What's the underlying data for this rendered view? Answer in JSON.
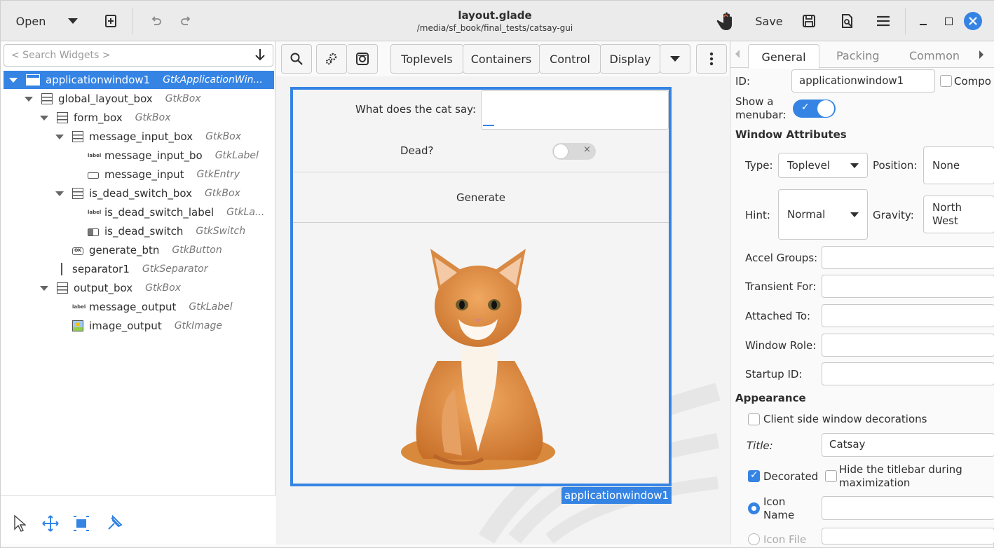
{
  "header": {
    "open_label": "Open",
    "title": "layout.glade",
    "path": "/media/sf_book/final_tests/catsay-gui",
    "save_label": "Save"
  },
  "left": {
    "search_placeholder": "< Search Widgets >",
    "tree": [
      {
        "name": "applicationwindow1",
        "type": "GtkApplicationWin...",
        "depth": 0,
        "expander": true,
        "icon": "window-icon",
        "selected": true
      },
      {
        "name": "global_layout_box",
        "type": "GtkBox",
        "depth": 1,
        "expander": true,
        "icon": "box-icon"
      },
      {
        "name": "form_box",
        "type": "GtkBox",
        "depth": 2,
        "expander": true,
        "icon": "box-icon"
      },
      {
        "name": "message_input_box",
        "type": "GtkBox",
        "depth": 3,
        "expander": true,
        "icon": "box-icon"
      },
      {
        "name": "message_input_bo",
        "type": "GtkLabel",
        "depth": 4,
        "icon": "label-icon"
      },
      {
        "name": "message_input",
        "type": "GtkEntry",
        "depth": 4,
        "icon": "entry-icon"
      },
      {
        "name": "is_dead_switch_box",
        "type": "GtkBox",
        "depth": 3,
        "expander": true,
        "icon": "box-icon"
      },
      {
        "name": "is_dead_switch_label",
        "type": "GtkLa...",
        "depth": 4,
        "icon": "label-icon"
      },
      {
        "name": "is_dead_switch",
        "type": "GtkSwitch",
        "depth": 4,
        "icon": "switch-icon"
      },
      {
        "name": "generate_btn",
        "type": "GtkButton",
        "depth": 3,
        "icon": "button-icon"
      },
      {
        "name": "separator1",
        "type": "GtkSeparator",
        "depth": 2,
        "icon": "separator-icon"
      },
      {
        "name": "output_box",
        "type": "GtkBox",
        "depth": 2,
        "expander": true,
        "icon": "box-icon"
      },
      {
        "name": "message_output",
        "type": "GtkLabel",
        "depth": 3,
        "icon": "label-icon"
      },
      {
        "name": "image_output",
        "type": "GtkImage",
        "depth": 3,
        "icon": "image-icon"
      }
    ]
  },
  "palette": {
    "tabs": [
      "Toplevels",
      "Containers",
      "Control",
      "Display"
    ]
  },
  "preview": {
    "question_label": "What does the cat say:",
    "dead_label": "Dead?",
    "generate_label": "Generate",
    "window_name": "applicationwindow1"
  },
  "props": {
    "tabs": [
      "General",
      "Packing",
      "Common"
    ],
    "id_label": "ID:",
    "id_value": "applicationwindow1",
    "compo_label": "Compo",
    "menubar_label_1": "Show a",
    "menubar_label_2": "menubar:",
    "window_attrs": "Window Attributes",
    "type_label": "Type:",
    "type_value": "Toplevel",
    "position_label": "Position:",
    "position_value": "None",
    "hint_label": "Hint:",
    "hint_value": "Normal",
    "gravity_label": "Gravity:",
    "gravity_value_1": "North",
    "gravity_value_2": "West",
    "accel_label": "Accel Groups:",
    "transient_label": "Transient For:",
    "attached_label": "Attached To:",
    "role_label": "Window Role:",
    "startup_label": "Startup ID:",
    "appearance": "Appearance",
    "csd_label": "Client side window decorations",
    "title_label": "Title:",
    "title_value": "Catsay",
    "decorated_label": "Decorated",
    "hide_label_1": "Hide the titlebar during",
    "hide_label_2": "maximization",
    "icon_name_1": "Icon",
    "icon_name_2": "Name",
    "icon_file": "Icon File"
  },
  "colors": {
    "accent": "#3584e4",
    "close": "#3584e4"
  }
}
